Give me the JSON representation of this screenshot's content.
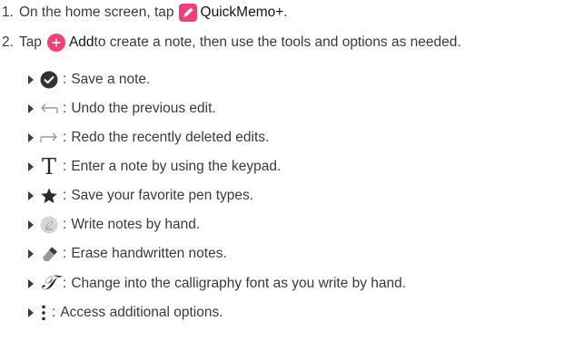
{
  "steps": [
    {
      "number": "1.",
      "before": "On the home screen, tap",
      "app_label": "QuickMemo+",
      "after": ".",
      "icon": "quickmemo-pencil-icon"
    },
    {
      "number": "2.",
      "before": "Tap",
      "app_label": "Add",
      "after": " to create a note, then use the tools and options as needed.",
      "icon": "add-plus-icon"
    }
  ],
  "tools": [
    {
      "icon": "checkmark-save-icon",
      "text": "Save a note."
    },
    {
      "icon": "undo-arrow-icon",
      "text": "Undo the previous edit."
    },
    {
      "icon": "redo-arrow-icon",
      "text": "Redo the recently deleted edits."
    },
    {
      "icon": "text-t-icon",
      "glyph": "T",
      "text": "Enter a note by using the keypad."
    },
    {
      "icon": "star-icon",
      "text": "Save your favorite pen types."
    },
    {
      "icon": "pen-handwriting-icon",
      "text": "Write notes by hand."
    },
    {
      "icon": "eraser-icon",
      "text": "Erase handwritten notes."
    },
    {
      "icon": "calligraphy-font-icon",
      "glyph": "𝒯",
      "text": "Change into the calligraphy font as you write by hand."
    },
    {
      "icon": "more-options-icon",
      "text": "Access additional options."
    }
  ],
  "separator": ":",
  "colors": {
    "accent_pink": "#ee3f79",
    "text": "#3a3a3a",
    "label_dark": "#141414"
  }
}
